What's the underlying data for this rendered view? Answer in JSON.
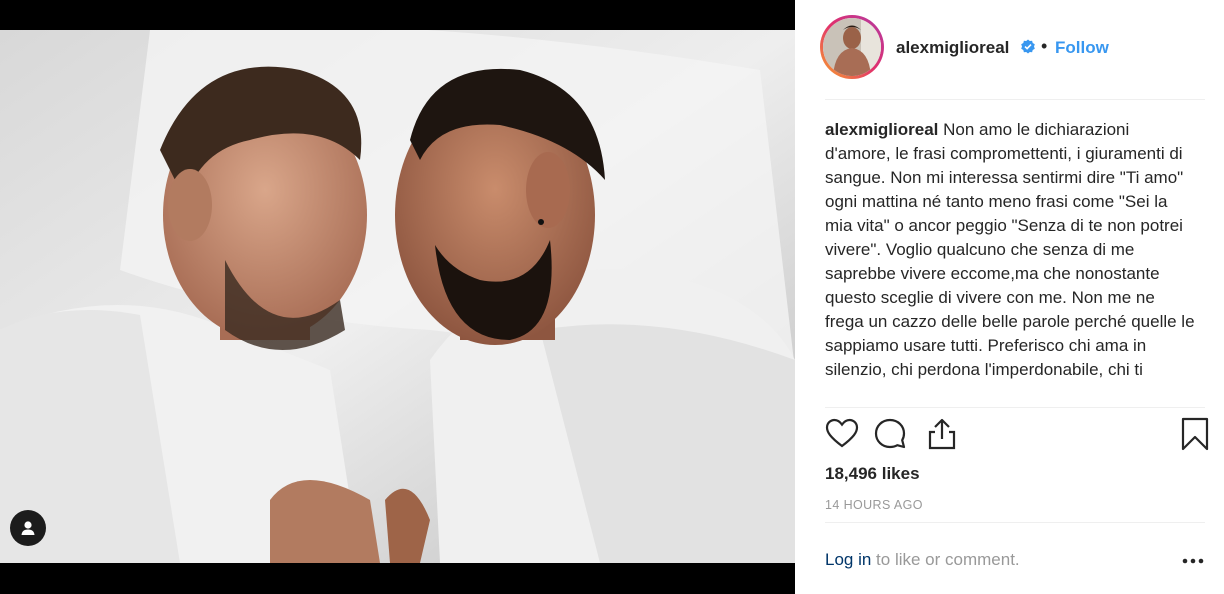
{
  "post": {
    "username": "alexmiglioreal",
    "follow_label": "Follow",
    "separator": "•",
    "caption_text": "Non amo le dichiarazioni d'amore, le frasi compromettenti, i giuramenti di sangue. Non mi interessa sentirmi dire \"Ti amo\" ogni mattina né tanto meno frasi come \"Sei la mia vita\" o ancor peggio \"Senza di te non potrei vivere\". Voglio qualcuno che senza di me saprebbe vivere eccome,ma che nonostante questo sceglie di vivere con me. Non me ne frega un cazzo delle belle parole perché quelle le sappiamo usare tutti. Preferisco chi ama in silenzio, chi perdona l'imperdonabile, chi ti",
    "likes": "18,496 likes",
    "timestamp": "14 HOURS AGO"
  },
  "footer": {
    "login_link": "Log in",
    "login_rest": " to like or comment."
  },
  "colors": {
    "accent": "#3897f0",
    "verified": "#3897f0",
    "text": "#262626",
    "muted": "#999999",
    "link_dark": "#003569"
  },
  "icons": [
    "heart-icon",
    "comment-icon",
    "share-icon",
    "bookmark-icon",
    "tagged-user-icon",
    "verified-badge-icon",
    "more-options-icon"
  ]
}
